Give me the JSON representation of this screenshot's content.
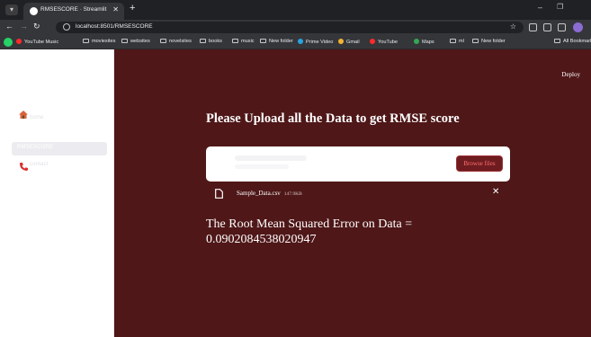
{
  "browser": {
    "tab_title": "RMSESCORE · Streamlit",
    "url": "localhost:8501/RMSESCORE",
    "bookmarks": [
      "YouTube Music",
      "moviesites",
      "websites",
      "novelsites",
      "books",
      "music",
      "New folder",
      "Prime Video",
      "Gmail",
      "YouTube",
      "Maps",
      "ml",
      "New folder"
    ],
    "all_bookmarks": "All Bookmarks"
  },
  "sidebar": {
    "items": [
      {
        "label": "home",
        "icon": "home-icon"
      },
      {
        "label": "RMSESCORE",
        "icon": ""
      },
      {
        "label": "contact",
        "icon": "phone-icon"
      }
    ]
  },
  "header": {
    "deploy_label": "Deploy"
  },
  "main": {
    "title": "Please Upload all the Data to get RMSE score",
    "uploader": {
      "button_label": "Browse files",
      "file_name": "Sample_Data.csv",
      "file_size": "147.9KB"
    },
    "result_label": "The Root Mean Squared Error on Data =",
    "result_value": "0.0902084538020947"
  },
  "colors": {
    "main_bg": "#4f1718",
    "browse_text": "#ff6f73",
    "browse_bg": "#6e1c1f"
  }
}
